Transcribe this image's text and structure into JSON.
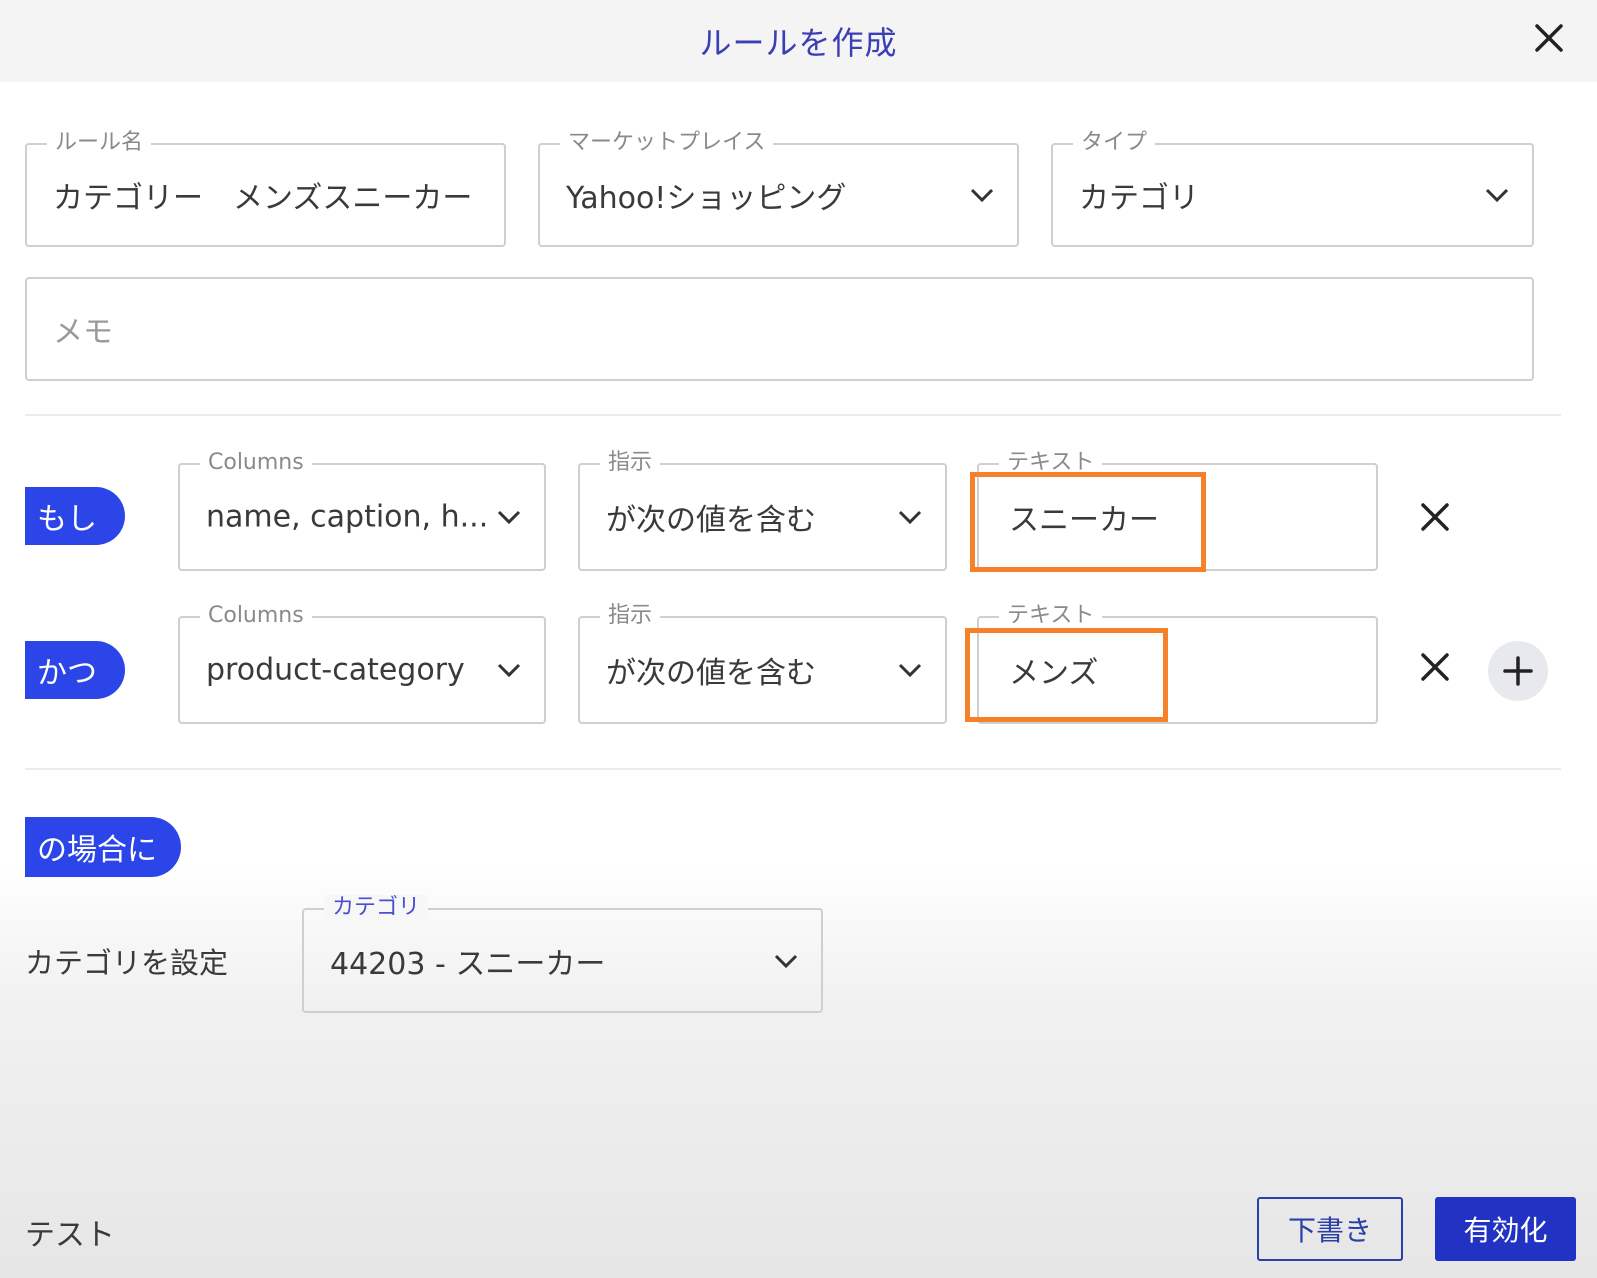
{
  "dialog": {
    "title": "ルールを作成",
    "close_icon": "close-icon"
  },
  "rule": {
    "name": {
      "label": "ルール名",
      "value": "カテゴリー　メンズスニーカー"
    },
    "marketplace": {
      "label": "マーケットプレイス",
      "value": "Yahoo!ショッピング"
    },
    "type": {
      "label": "タイプ",
      "value": "カテゴリ"
    },
    "memo": {
      "placeholder": "メモ"
    }
  },
  "conditions": [
    {
      "connector": "もし",
      "columns": {
        "label": "Columns",
        "value": "name, caption, h..."
      },
      "operator": {
        "label": "指示",
        "value": "が次の値を含む"
      },
      "text": {
        "label": "テキスト",
        "value": "スニーカー"
      }
    },
    {
      "connector": "かつ",
      "columns": {
        "label": "Columns",
        "value": "product-category"
      },
      "operator": {
        "label": "指示",
        "value": "が次の値を含む"
      },
      "text": {
        "label": "テキスト",
        "value": "メンズ"
      }
    }
  ],
  "action": {
    "connector": "の場合に",
    "set_label": "カテゴリを設定",
    "category": {
      "label": "カテゴリ",
      "value": "44203 - スニーカー"
    }
  },
  "footer": {
    "test_label": "テスト",
    "draft_button": "下書き",
    "enable_button": "有効化"
  },
  "colors": {
    "accent": "#2b45e8",
    "title": "#3b3fb5",
    "highlight": "#f5822a"
  }
}
